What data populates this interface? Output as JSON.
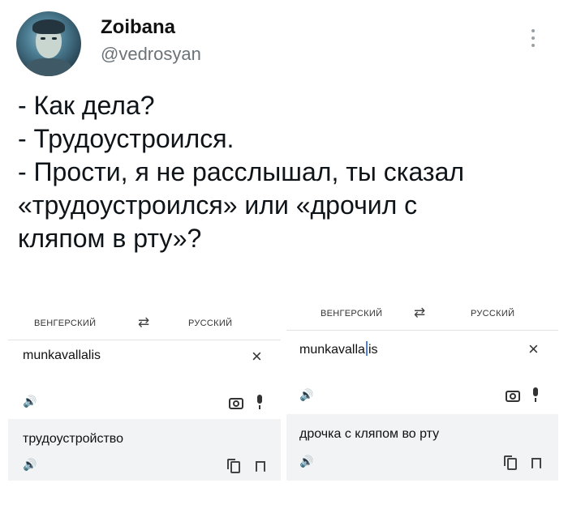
{
  "tweet": {
    "author_name": "Zoibana",
    "author_handle": "@vedrosyan",
    "lines": [
      "- Как дела?",
      "- Трудоустроился.",
      "- Прости, я не расслышал, ты сказал",
      "«трудоустроился» или «дрочил с",
      "кляпом в рту»?"
    ]
  },
  "screenshot_left": {
    "source_lang": "ВЕНГЕРСКИЙ",
    "target_lang": "РУССКИЙ",
    "swap_icon": "⇄",
    "source_text": "munkavallalis",
    "clear_icon": "×",
    "speaker_icon": "🔊",
    "result_text": "трудоустройство"
  },
  "screenshot_right": {
    "source_lang": "ВЕНГЕРСКИЙ",
    "target_lang": "РУССКИЙ",
    "swap_icon": "⇄",
    "source_text_before_cursor": "munkavalla",
    "source_text_after_cursor": "is",
    "clear_icon": "×",
    "speaker_icon": "🔊",
    "result_text": "дрочка с кляпом во рту"
  }
}
